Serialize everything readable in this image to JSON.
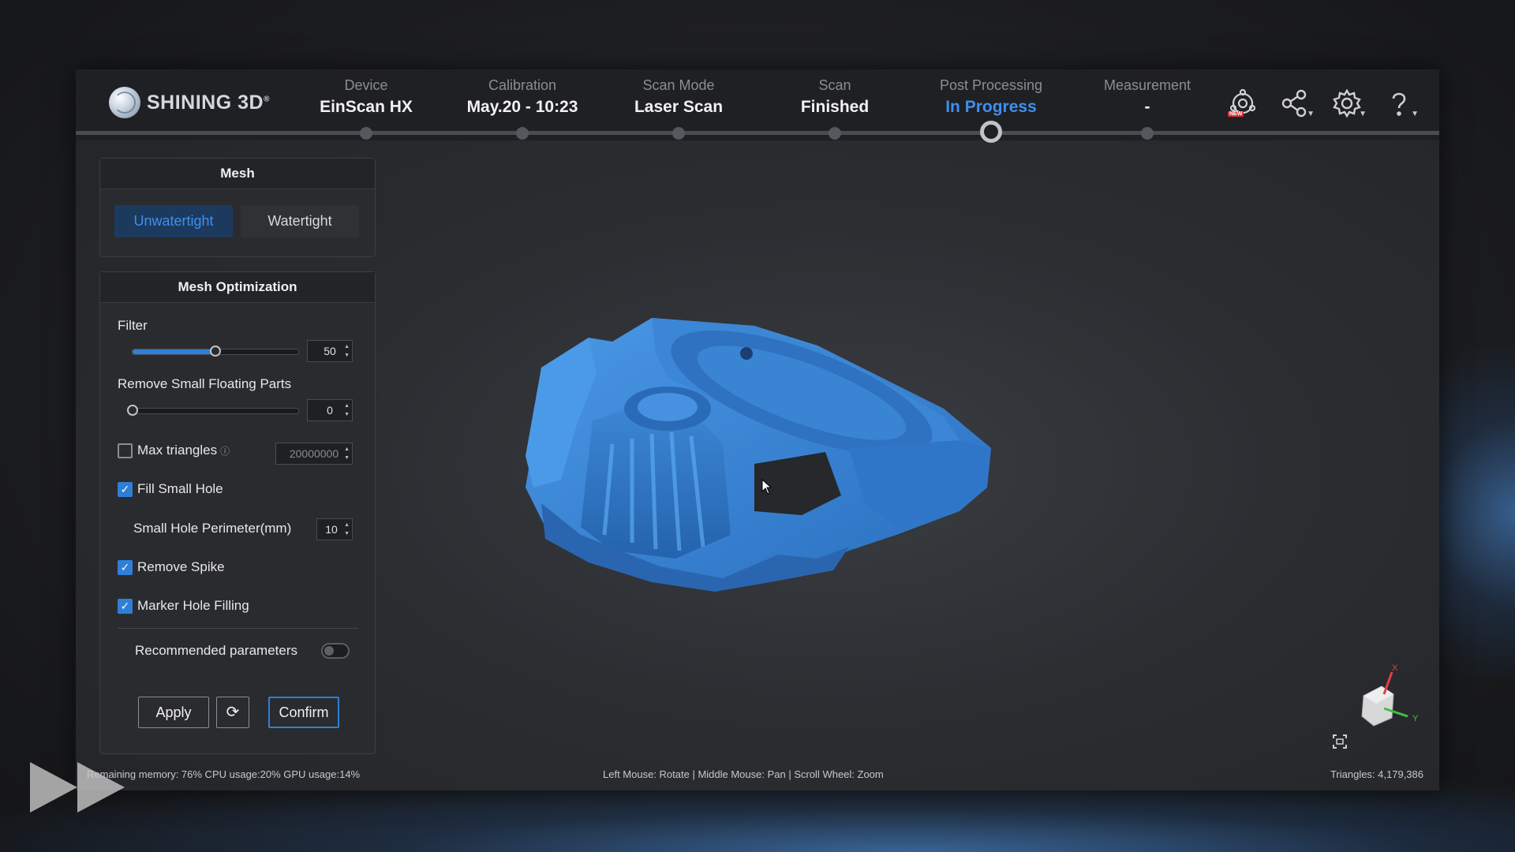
{
  "brand": {
    "logo_text": "SHINING 3D",
    "reg": "®"
  },
  "steps": [
    {
      "label": "Device",
      "value": "EinScan HX",
      "active": false
    },
    {
      "label": "Calibration",
      "value": "May.20 - 10:23",
      "active": false
    },
    {
      "label": "Scan Mode",
      "value": "Laser Scan",
      "active": false
    },
    {
      "label": "Scan",
      "value": "Finished",
      "active": false
    },
    {
      "label": "Post Processing",
      "value": "In Progress",
      "active": true
    },
    {
      "label": "Measurement",
      "value": "-",
      "active": false
    }
  ],
  "header_icons": [
    "new-feature-icon",
    "share-icon",
    "settings-icon",
    "help-icon"
  ],
  "new_badge": "NEW",
  "mesh_panel": {
    "title": "Mesh",
    "tabs": [
      {
        "label": "Unwatertight",
        "selected": true
      },
      {
        "label": "Watertight",
        "selected": false
      }
    ]
  },
  "optimization": {
    "title": "Mesh Optimization",
    "filter": {
      "label": "Filter",
      "value": "50",
      "level": 0.5
    },
    "remove_floating": {
      "label": "Remove Small Floating Parts",
      "value": "0",
      "level": 0.0
    },
    "max_triangles": {
      "label": "Max triangles",
      "checked": false,
      "value": "20000000"
    },
    "fill_small_hole": {
      "label": "Fill Small Hole",
      "checked": true
    },
    "small_hole_perimeter": {
      "label": "Small Hole Perimeter(mm)",
      "value": "10"
    },
    "remove_spike": {
      "label": "Remove Spike",
      "checked": true
    },
    "marker_hole_filling": {
      "label": "Marker Hole Filling",
      "checked": true
    },
    "recommended": {
      "label": "Recommended parameters",
      "on": false
    },
    "buttons": {
      "apply": "Apply",
      "confirm": "Confirm"
    }
  },
  "status": {
    "left": "Remaining memory: 76% CPU usage:20% GPU usage:14%",
    "center": "Left Mouse: Rotate | Middle Mouse: Pan | Scroll Wheel: Zoom",
    "right": "Triangles: 4,179,386"
  },
  "axes": {
    "x": "X",
    "y": "Y"
  },
  "colors": {
    "accent": "#2f7fd8",
    "active_text": "#3d8ff0",
    "model": "#3a86d6"
  }
}
